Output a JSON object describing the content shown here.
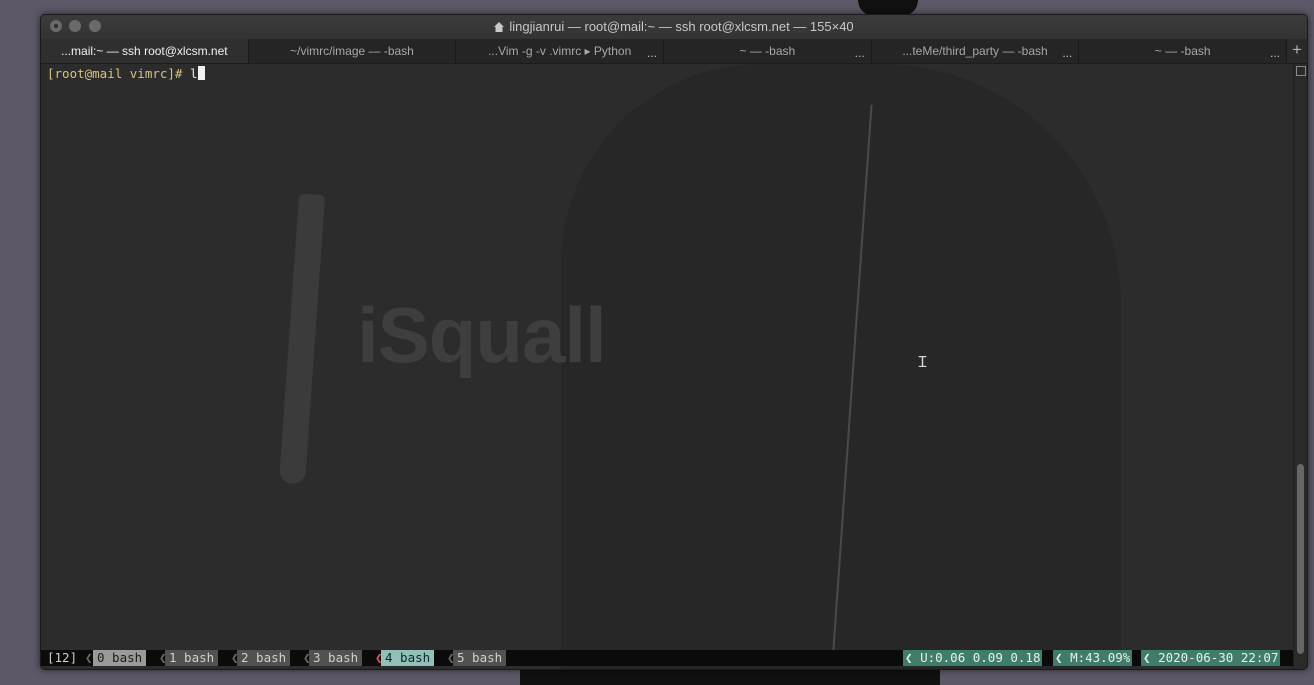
{
  "window": {
    "title": "lingjianrui — root@mail:~ — ssh root@xlcsm.net — 155×40",
    "title_icon": "home-icon"
  },
  "tabs": [
    {
      "label": "...mail:~ — ssh root@xlcsm.net",
      "active": true
    },
    {
      "label": "~/vimrc/image — -bash"
    },
    {
      "label": "...Vim -g -v .vimrc ▸ Python",
      "has_more": true
    },
    {
      "label": "~ — -bash",
      "has_more": true
    },
    {
      "label": "...teMe/third_party — -bash",
      "has_more": true
    },
    {
      "label": "~ — -bash",
      "has_more": true
    }
  ],
  "tab_more_label": "...",
  "add_tab_label": "+",
  "terminal": {
    "prompt": "[root@mail vimrc]# ",
    "input": "l",
    "background_text": "iSquall"
  },
  "tmux": {
    "session": "[12]",
    "windows": [
      {
        "label": "0 bash"
      },
      {
        "label": "1 bash"
      },
      {
        "label": "2 bash"
      },
      {
        "label": "3 bash"
      },
      {
        "label": "4 bash"
      },
      {
        "label": "5 bash"
      }
    ],
    "load": "U:0.06 0.09 0.18",
    "memory": "M:43.09%",
    "datetime": "2020-06-30 22:07"
  },
  "colors": {
    "prompt": "#d7c37a",
    "status_accent": "#3f7d6a",
    "active_window": "#9a9a9a"
  }
}
